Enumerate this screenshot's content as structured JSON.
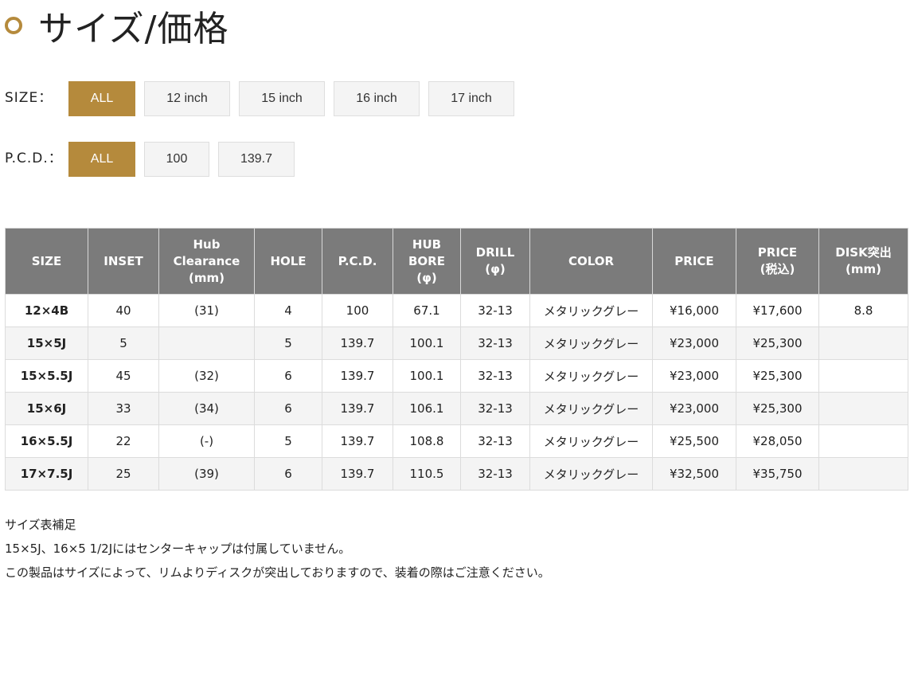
{
  "page": {
    "title": "サイズ/価格"
  },
  "filters": {
    "size": {
      "label": "SIZE：",
      "options": [
        "ALL",
        "12 inch",
        "15 inch",
        "16 inch",
        "17 inch"
      ],
      "selected": "ALL"
    },
    "pcd": {
      "label": "P.C.D.：",
      "options": [
        "ALL",
        "100",
        "139.7"
      ],
      "selected": "ALL"
    }
  },
  "table": {
    "headers": [
      [
        "SIZE"
      ],
      [
        "INSET"
      ],
      [
        "Hub",
        "Clearance",
        "(mm)"
      ],
      [
        "HOLE"
      ],
      [
        "P.C.D."
      ],
      [
        "HUB",
        "BORE",
        "(φ)"
      ],
      [
        "DRILL",
        "(φ)"
      ],
      [
        "COLOR"
      ],
      [
        "PRICE"
      ],
      [
        "PRICE",
        "(税込)"
      ],
      [
        "DISK突出",
        "(mm)"
      ]
    ],
    "rows": [
      [
        "12×4B",
        "40",
        "(31)",
        "4",
        "100",
        "67.1",
        "32-13",
        "メタリックグレー",
        "¥16,000",
        "¥17,600",
        "8.8"
      ],
      [
        "15×5J",
        "5",
        "",
        "5",
        "139.7",
        "100.1",
        "32-13",
        "メタリックグレー",
        "¥23,000",
        "¥25,300",
        ""
      ],
      [
        "15×5.5J",
        "45",
        "(32)",
        "6",
        "139.7",
        "100.1",
        "32-13",
        "メタリックグレー",
        "¥23,000",
        "¥25,300",
        ""
      ],
      [
        "15×6J",
        "33",
        "(34)",
        "6",
        "139.7",
        "106.1",
        "32-13",
        "メタリックグレー",
        "¥23,000",
        "¥25,300",
        ""
      ],
      [
        "16×5.5J",
        "22",
        "(-)",
        "5",
        "139.7",
        "108.8",
        "32-13",
        "メタリックグレー",
        "¥25,500",
        "¥28,050",
        ""
      ],
      [
        "17×7.5J",
        "25",
        "(39)",
        "6",
        "139.7",
        "110.5",
        "32-13",
        "メタリックグレー",
        "¥32,500",
        "¥35,750",
        ""
      ]
    ]
  },
  "notes": [
    "サイズ表補足",
    "15×5J、16×5 1/2Jにはセンターキャップは付属していません。",
    "この製品はサイズによって、リムよりディスクが突出しておりますので、装着の際はご注意ください。"
  ],
  "colors": {
    "accent": "#b58a3c",
    "header_bg": "#7b7b7b",
    "row_alt": "#f4f4f4"
  }
}
